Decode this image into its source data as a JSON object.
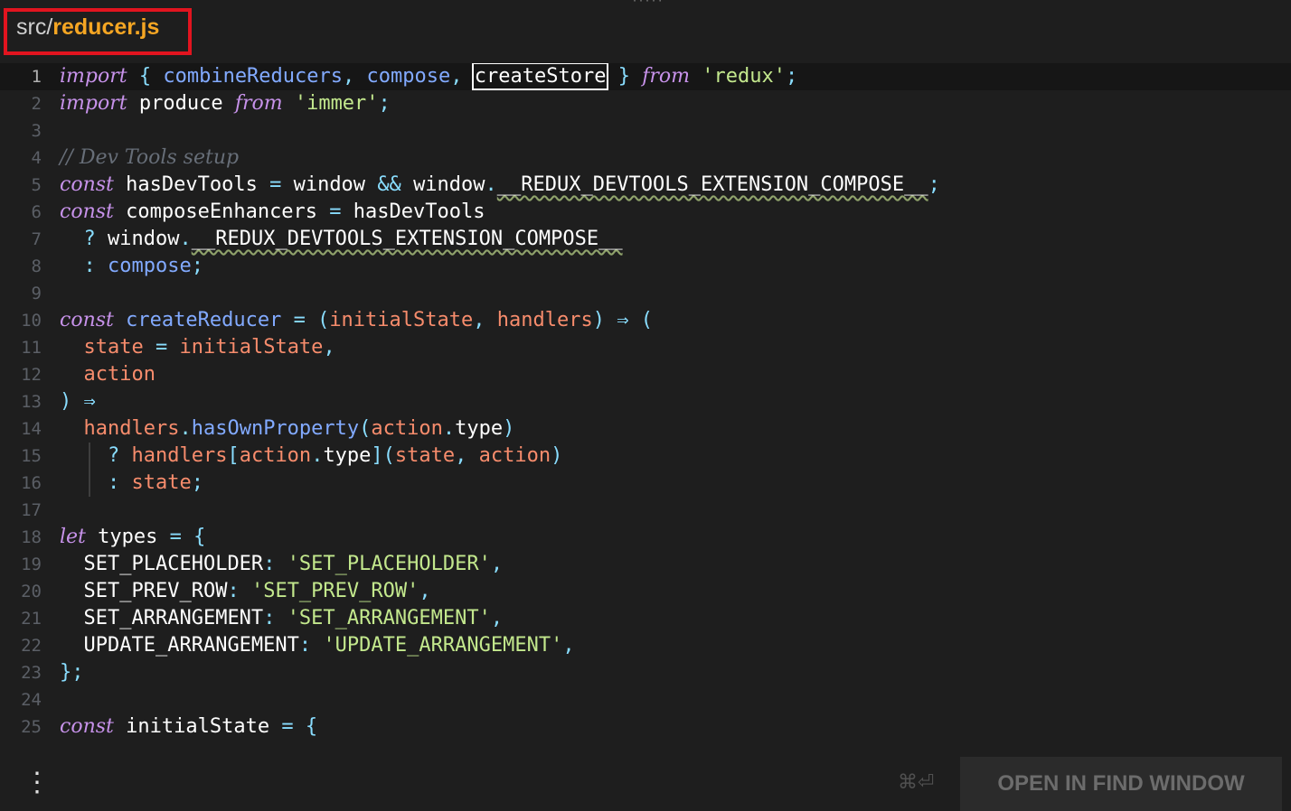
{
  "file": {
    "dir": "src/",
    "name": "reducer.js"
  },
  "line_numbers": [
    "1",
    "2",
    "3",
    "4",
    "5",
    "6",
    "7",
    "8",
    "9",
    "10",
    "11",
    "12",
    "13",
    "14",
    "15",
    "16",
    "17",
    "18",
    "19",
    "20",
    "21",
    "22",
    "23",
    "24",
    "25"
  ],
  "current_line": 1,
  "code": {
    "l1": [
      "import",
      "{",
      "combineReducers",
      ",",
      "compose",
      ",",
      "createStore",
      "}",
      "from",
      "'redux'",
      ";"
    ],
    "l2": [
      "import",
      "produce",
      "from",
      "'immer'",
      ";"
    ],
    "l4": [
      "// Dev Tools setup"
    ],
    "l5": [
      "const",
      "hasDevTools",
      "=",
      "window",
      "&&",
      "window",
      ".",
      "__REDUX_DEVTOOLS_EXTENSION_COMPOSE__",
      ";"
    ],
    "l6": [
      "const",
      "composeEnhancers",
      "=",
      "hasDevTools"
    ],
    "l7": [
      "?",
      "window",
      ".",
      "__REDUX_DEVTOOLS_EXTENSION_COMPOSE__"
    ],
    "l8": [
      ":",
      "compose",
      ";"
    ],
    "l10": [
      "const",
      "createReducer",
      "=",
      "(",
      "initialState",
      ",",
      "handlers",
      ")",
      "⇒",
      "("
    ],
    "l11": [
      "state",
      "=",
      "initialState",
      ","
    ],
    "l12": [
      "action"
    ],
    "l13": [
      ")",
      "⇒"
    ],
    "l14": [
      "handlers",
      ".",
      "hasOwnProperty",
      "(",
      "action",
      ".",
      "type",
      ")"
    ],
    "l15": [
      "?",
      "handlers",
      "[",
      "action",
      ".",
      "type",
      "]",
      "(",
      "state",
      ",",
      "action",
      ")"
    ],
    "l16": [
      ":",
      "state",
      ";"
    ],
    "l18": [
      "let",
      "types",
      "=",
      "{"
    ],
    "l19": [
      "SET_PLACEHOLDER",
      ":",
      "'SET_PLACEHOLDER'",
      ","
    ],
    "l20": [
      "SET_PREV_ROW",
      ":",
      "'SET_PREV_ROW'",
      ","
    ],
    "l21": [
      "SET_ARRANGEMENT",
      ":",
      "'SET_ARRANGEMENT'",
      ","
    ],
    "l22": [
      "UPDATE_ARRANGEMENT",
      ":",
      "'UPDATE_ARRANGEMENT'",
      ","
    ],
    "l23": [
      "}",
      ";"
    ],
    "l25": [
      "const",
      "initialState",
      "=",
      "{"
    ]
  },
  "bottom_bar": {
    "menu_icon": "⋮",
    "shortcut": "⌘⏎",
    "open_find_label": "OPEN IN FIND WINDOW"
  },
  "colors": {
    "background": "#1e1e1e",
    "keyword": "#c792ea",
    "function": "#82aaff",
    "punctuation": "#89ddff",
    "string": "#c3e88d",
    "parameter": "#f78c6c",
    "comment": "#676e78",
    "filename_accent": "#f5a623",
    "highlight_box": "#e2141f"
  }
}
